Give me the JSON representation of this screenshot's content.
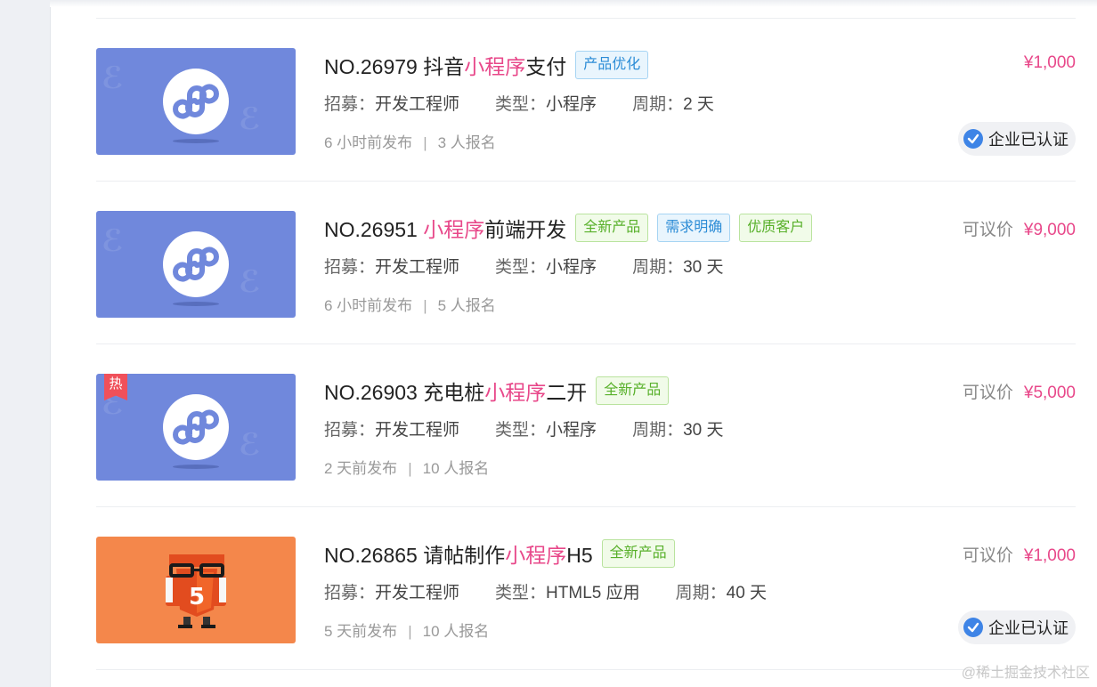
{
  "projects": [
    {
      "title_pre": "NO.26979 抖音",
      "title_hl": "小程序",
      "title_post": "支付",
      "tags": [
        "产品优化"
      ],
      "recruit_label": "招募：",
      "recruit_value": "开发工程师",
      "type_label": "类型：",
      "type_value": "小程序",
      "period_label": "周期：",
      "period_value": "2 天",
      "posted": "6 小时前发布",
      "separator": "|",
      "signups": "3 人报名",
      "negotiable": "",
      "price": "¥1,000",
      "verified": "企业已认证",
      "hot": "",
      "thumb_icon": "mini-program-icon"
    },
    {
      "title_pre": "NO.26951 ",
      "title_hl": "小程序",
      "title_post": "前端开发",
      "tags": [
        "全新产品",
        "需求明确",
        "优质客户"
      ],
      "recruit_label": "招募：",
      "recruit_value": "开发工程师",
      "type_label": "类型：",
      "type_value": "小程序",
      "period_label": "周期：",
      "period_value": "30 天",
      "posted": "6 小时前发布",
      "separator": "|",
      "signups": "5 人报名",
      "negotiable": "可议价",
      "price": "¥9,000",
      "verified": "",
      "hot": "",
      "thumb_icon": "mini-program-icon"
    },
    {
      "title_pre": "NO.26903 充电桩",
      "title_hl": "小程序",
      "title_post": "二开",
      "tags": [
        "全新产品"
      ],
      "recruit_label": "招募：",
      "recruit_value": "开发工程师",
      "type_label": "类型：",
      "type_value": "小程序",
      "period_label": "周期：",
      "period_value": "30 天",
      "posted": "2 天前发布",
      "separator": "|",
      "signups": "10 人报名",
      "negotiable": "可议价",
      "price": "¥5,000",
      "verified": "",
      "hot": "热",
      "thumb_icon": "mini-program-icon"
    },
    {
      "title_pre": "NO.26865 请帖制作",
      "title_hl": "小程序",
      "title_post": "H5",
      "tags": [
        "全新产品"
      ],
      "recruit_label": "招募：",
      "recruit_value": "开发工程师",
      "type_label": "类型：",
      "type_value": "HTML5 应用",
      "period_label": "周期：",
      "period_value": "40 天",
      "posted": "5 天前发布",
      "separator": "|",
      "signups": "10 人报名",
      "negotiable": "可议价",
      "price": "¥1,000",
      "verified": "企业已认证",
      "hot": "",
      "thumb_icon": "html5-mascot-icon"
    }
  ],
  "tag_styles": {
    "产品优化": "blue",
    "需求明确": "blue",
    "全新产品": "green",
    "优质客户": "green"
  },
  "colors": {
    "highlight": "#e8488a",
    "thumb_blue": "#7088dc",
    "thumb_orange": "#f4874b",
    "verified_check": "#3e84e6"
  },
  "watermark": "@稀土掘金技术社区"
}
